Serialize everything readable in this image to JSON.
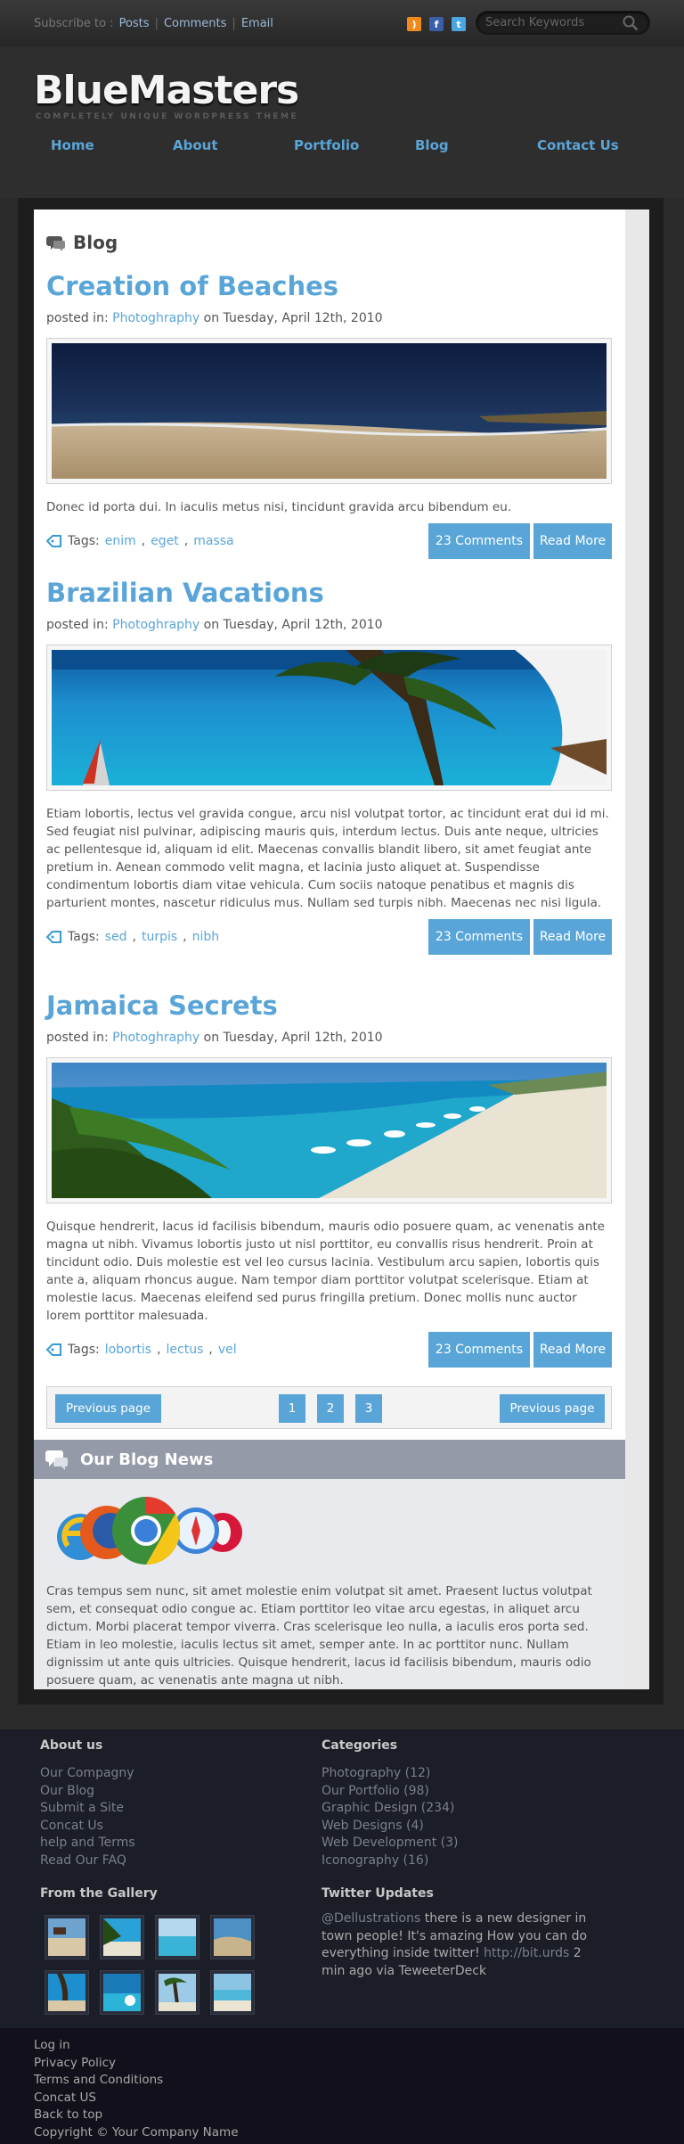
{
  "topbar": {
    "subscribe_label": "Subscribe to :",
    "links": [
      "Posts",
      "Comments",
      "Email"
    ],
    "search_placeholder": "Search Keywords",
    "social_icons": [
      "rss-icon",
      "facebook-icon",
      "twitter-icon"
    ]
  },
  "header": {
    "logo": "BlueMasters",
    "tagline": "COMPLETELY UNIQUE WORDPRESS THEME",
    "nav": [
      "Home",
      "About",
      "Portfolio",
      "Blog",
      "Contact Us"
    ]
  },
  "blog": {
    "heading": "Blog",
    "posted_in_label": "posted in:",
    "tags_label": "Tags:",
    "posts": [
      {
        "title": "Creation of Beaches",
        "category": "Photoghraphy",
        "date": "on Tuesday, April 12th, 2010",
        "excerpt": "Donec id porta dui. In iaculis metus nisi, tincidunt gravida arcu bibendum eu.",
        "tags": [
          "enim",
          "eget",
          "massa"
        ],
        "comments": "23 Comments",
        "read_more": "Read More"
      },
      {
        "title": "Brazilian Vacations",
        "category": "Photoghraphy",
        "date": "on Tuesday, April 12th, 2010",
        "excerpt": "Etiam lobortis, lectus vel gravida congue, arcu nisl volutpat tortor, ac tincidunt erat dui id mi. Sed feugiat nisl pulvinar, adipiscing mauris quis, interdum lectus. Duis ante neque, ultricies ac pellentesque id, aliquam id elit. Maecenas convallis blandit libero, sit amet feugiat ante pretium in. Aenean commodo velit magna, et lacinia justo aliquet at. Suspendisse condimentum lobortis diam vitae vehicula. Cum sociis natoque penatibus et magnis dis parturient montes, nascetur ridiculus mus. Nullam sed turpis nibh. Maecenas nec nisi ligula.",
        "tags": [
          "sed",
          "turpis",
          "nibh"
        ],
        "comments": "23 Comments",
        "read_more": "Read More"
      },
      {
        "title": "Jamaica Secrets",
        "category": "Photoghraphy",
        "date": "on Tuesday, April 12th, 2010",
        "excerpt": "Quisque hendrerit, lacus id facilisis bibendum, mauris odio posuere quam, ac venenatis ante magna ut nibh. Vivamus lobortis justo ut nisl porttitor, eu convallis risus hendrerit. Proin at tincidunt odio. Duis molestie est vel leo cursus lacinia. Vestibulum arcu sapien, lobortis quis ante a, aliquam rhoncus augue. Nam tempor diam porttitor volutpat scelerisque. Etiam at molestie lacus. Maecenas eleifend sed purus fringilla pretium. Donec mollis nunc auctor lorem porttitor malesuada.",
        "tags": [
          "lobortis",
          "lectus",
          "vel"
        ],
        "comments": "23 Comments",
        "read_more": "Read More"
      }
    ],
    "pager": {
      "prev_left": "Previous page",
      "pages": [
        "1",
        "2",
        "3"
      ],
      "prev_right": "Previous page"
    }
  },
  "news": {
    "heading": "Our Blog News",
    "text": "Cras tempus sem nunc, sit amet molestie enim volutpat sit amet. Praesent luctus volutpat sem, et consequat odio congue ac. Etiam porttitor leo vitae arcu egestas, in aliquet arcu dictum. Morbi placerat tempor viverra. Cras scelerisque leo nulla, a iaculis eros porta sed. Etiam in leo molestie, iaculis lectus sit amet, semper ante. In ac porttitor nunc. Nullam dignissim ut ante quis ultricies. Quisque hendrerit, lacus id facilisis bibendum, mauris odio posuere quam, ac venenatis ante magna ut nibh."
  },
  "footer": {
    "about_heading": "About us",
    "about_links": [
      "Our Compagny",
      "Our Blog",
      "Submit a Site",
      "Concat Us",
      "help and Terms",
      "Read Our FAQ"
    ],
    "categories_heading": "Categories",
    "categories": [
      "Photography (12)",
      "Our Portfolio (98)",
      "Graphic Design (234)",
      "Web Designs (4)",
      "Web Development (3)",
      "Iconography (16)"
    ],
    "gallery_heading": "From the Gallery",
    "twitter_heading": "Twitter Updates",
    "tweet_user": "@Dellustrations",
    "tweet_text": " there is a new designer in town people! It's amazing How you can do everything inside twitter!",
    "tweet_link": "http://bit.urds",
    "tweet_meta": " 2 min ago via TeweeterDeck",
    "bottom_links": [
      "Log in",
      "Privacy Policy",
      "Terms and Conditions",
      "Concat US",
      "Back to top"
    ],
    "copyright": "Copyright © Your Company Name"
  },
  "colors": {
    "accent": "#5aa5d8",
    "header_bg": "#2e2e2e",
    "footer_bg": "#1b1d27",
    "news_bar": "#959aa8"
  }
}
